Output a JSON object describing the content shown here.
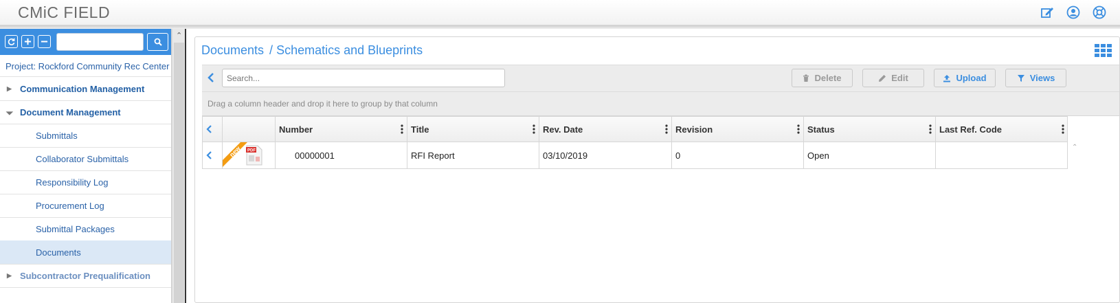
{
  "app": {
    "title": "CMiC FIELD"
  },
  "header_icons": [
    "edit-icon",
    "user-icon",
    "help-icon"
  ],
  "sidebar": {
    "search_placeholder": "",
    "project_label": "Project: Rockford Community Rec Center",
    "items": [
      {
        "label": "Communication Management",
        "type": "group",
        "expanded": false
      },
      {
        "label": "Document Management",
        "type": "group",
        "expanded": true
      },
      {
        "label": "Submittals",
        "type": "child"
      },
      {
        "label": "Collaborator Submittals",
        "type": "child"
      },
      {
        "label": "Responsibility Log",
        "type": "child"
      },
      {
        "label": "Procurement Log",
        "type": "child"
      },
      {
        "label": "Submittal Packages",
        "type": "child"
      },
      {
        "label": "Documents",
        "type": "child",
        "selected": true
      },
      {
        "label": "Subcontractor Prequalification",
        "type": "group",
        "expanded": false
      }
    ]
  },
  "main": {
    "breadcrumb": {
      "root": "Documents",
      "separator": "/",
      "current": "Schematics and Blueprints"
    },
    "toolbar": {
      "search_placeholder": "Search...",
      "delete_label": "Delete",
      "edit_label": "Edit",
      "upload_label": "Upload",
      "views_label": "Views"
    },
    "group_hint": "Drag a column header and drop it here to group by that column",
    "table": {
      "columns": [
        "Number",
        "Title",
        "Rev. Date",
        "Revision",
        "Status",
        "Last Ref. Code"
      ],
      "rows": [
        {
          "badge": "new",
          "file_type": "PDF",
          "number": "00000001",
          "title": "RFI Report",
          "rev_date": "03/10/2019",
          "revision": "0",
          "status": "Open",
          "last_ref_code": ""
        }
      ]
    }
  },
  "colors": {
    "accent": "#3b8ee0",
    "nav_text": "#2360a5",
    "badge": "#f39c12",
    "pdf": "#d9302c"
  }
}
